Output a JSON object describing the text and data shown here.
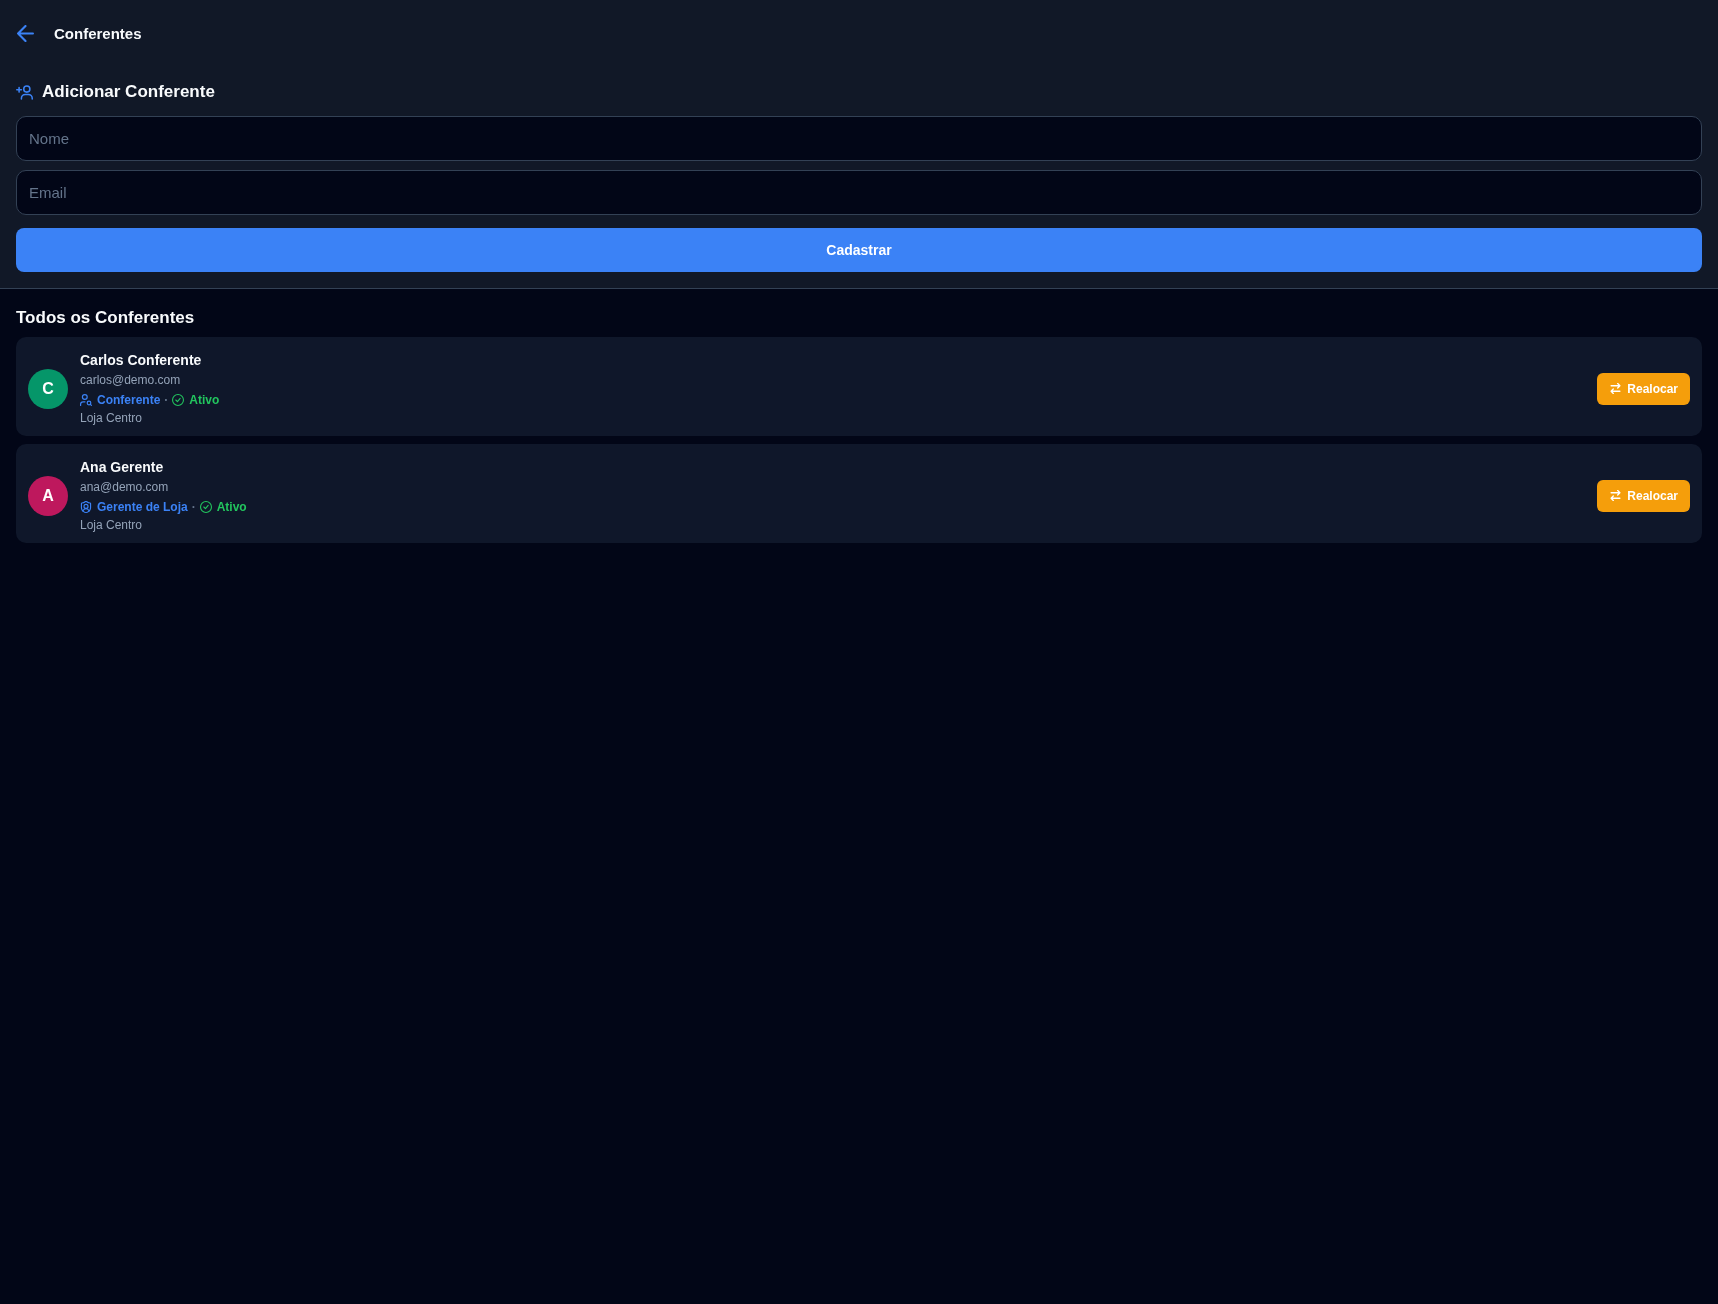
{
  "header": {
    "title": "Conferentes"
  },
  "add_form": {
    "title": "Adicionar Conferente",
    "fields": [
      {
        "placeholder": "Nome"
      },
      {
        "placeholder": "Email"
      }
    ],
    "submit_button": "Cadastrar"
  },
  "list": {
    "title": "Todos os Conferentes",
    "items": [
      {
        "initial": "C",
        "color": "#059669",
        "name": "Carlos Conferente",
        "email": "carlos@demo.com",
        "role": {
          "label": "Conferente",
          "kind": "inspector"
        },
        "separator": "·",
        "status": {
          "label": "Ativo",
          "active": true
        },
        "store": "Loja Centro",
        "action": "Realocar"
      },
      {
        "initial": "A",
        "color": "#be185d",
        "name": "Ana Gerente",
        "email": "ana@demo.com",
        "role": {
          "label": "Gerente de Loja",
          "kind": "manager"
        },
        "separator": "·",
        "status": {
          "label": "Ativo",
          "active": true
        },
        "store": "Loja Centro",
        "action": "Realocar"
      }
    ]
  }
}
